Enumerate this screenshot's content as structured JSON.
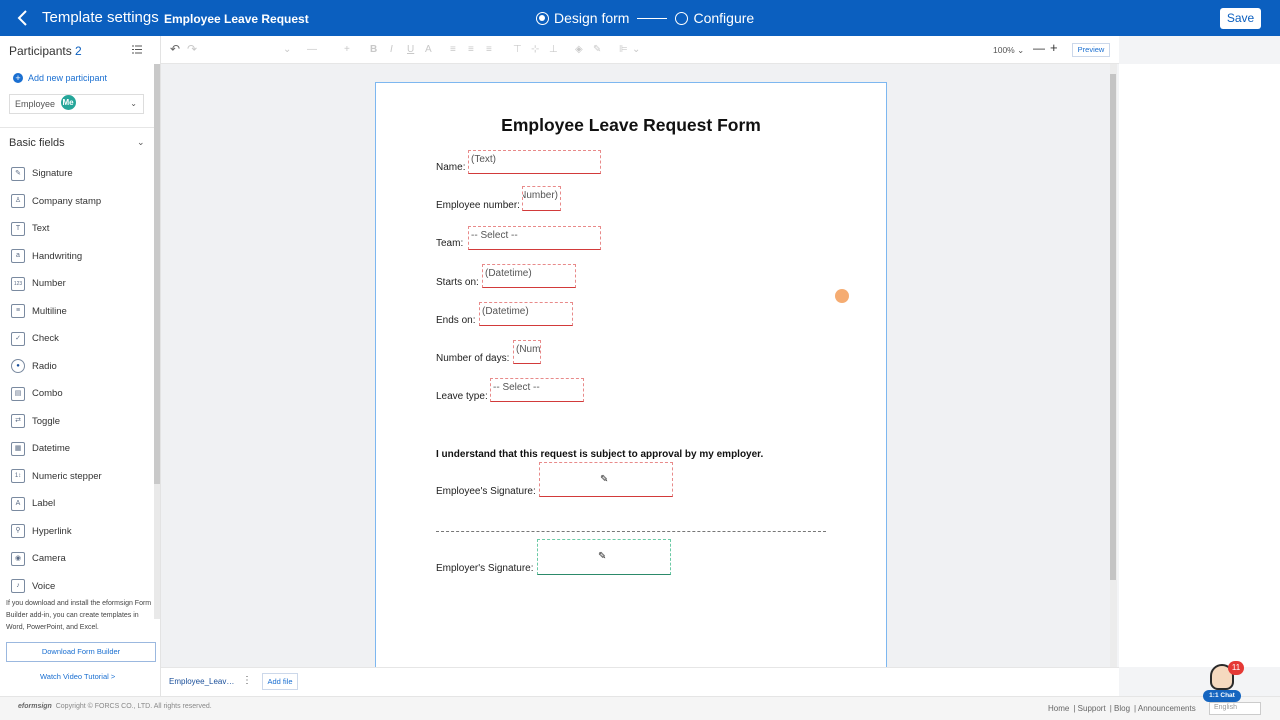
{
  "header": {
    "app_title": "Template settings",
    "doc_title": "Employee Leave Request",
    "steps": [
      "Design form",
      "Configure"
    ],
    "save_label": "Save"
  },
  "sidebar": {
    "participants_label": "Participants",
    "participants_count": "2",
    "add_participant": "Add new participant",
    "selected_participant": "Employee",
    "participant_badge": "Me",
    "basic_fields_label": "Basic fields",
    "fields": [
      {
        "label": "Signature",
        "icon": "✎"
      },
      {
        "label": "Company stamp",
        "icon": "♙"
      },
      {
        "label": "Text",
        "icon": "T"
      },
      {
        "label": "Handwriting",
        "icon": "a"
      },
      {
        "label": "Number",
        "icon": "123"
      },
      {
        "label": "Multiline",
        "icon": "≡"
      },
      {
        "label": "Check",
        "icon": "✓"
      },
      {
        "label": "Radio",
        "icon": "●"
      },
      {
        "label": "Combo",
        "icon": "▤"
      },
      {
        "label": "Toggle",
        "icon": "⇄"
      },
      {
        "label": "Datetime",
        "icon": "▦"
      },
      {
        "label": "Numeric stepper",
        "icon": "1↕"
      },
      {
        "label": "Label",
        "icon": "A"
      },
      {
        "label": "Hyperlink",
        "icon": "⚲"
      },
      {
        "label": "Camera",
        "icon": "◉"
      },
      {
        "label": "Voice",
        "icon": "♪"
      }
    ],
    "info_text": "If you download and install the eformsign Form Builder add-in, you can create templates in Word, PowerPoint, and Excel.",
    "download_label": "Download Form Builder",
    "tutorial_label": "Watch Video Tutorial >"
  },
  "toolbar": {
    "zoom": "100%",
    "preview_label": "Preview"
  },
  "form": {
    "title": "Employee Leave Request Form",
    "fields": [
      {
        "label": "Name",
        "value": "(Text)"
      },
      {
        "label": "Employee number",
        "value": "(Number)"
      },
      {
        "label": "Team",
        "value": "-- Select --"
      },
      {
        "label": "Starts on",
        "value": "(Datetime)"
      },
      {
        "label": "Ends on",
        "value": "(Datetime)"
      },
      {
        "label": "Number of days",
        "value": "(Num"
      },
      {
        "label": "Leave type",
        "value": "-- Select --"
      }
    ],
    "disclaimer": "I understand that this request is subject to approval by my employer.",
    "employee_signature_label": "Employee's Signature",
    "employer_signature_label": "Employer's Signature"
  },
  "bottom": {
    "file_tab": "Employee_Leav…",
    "add_file": "Add file"
  },
  "footer": {
    "brand": "eformsign",
    "copyright": "Copyright © FORCS CO., LTD. All rights reserved.",
    "links": [
      "Home",
      "Support",
      "Blog",
      "Announcements"
    ],
    "language": "English"
  },
  "chat": {
    "badge": "11",
    "label": "1:1 Chat"
  }
}
